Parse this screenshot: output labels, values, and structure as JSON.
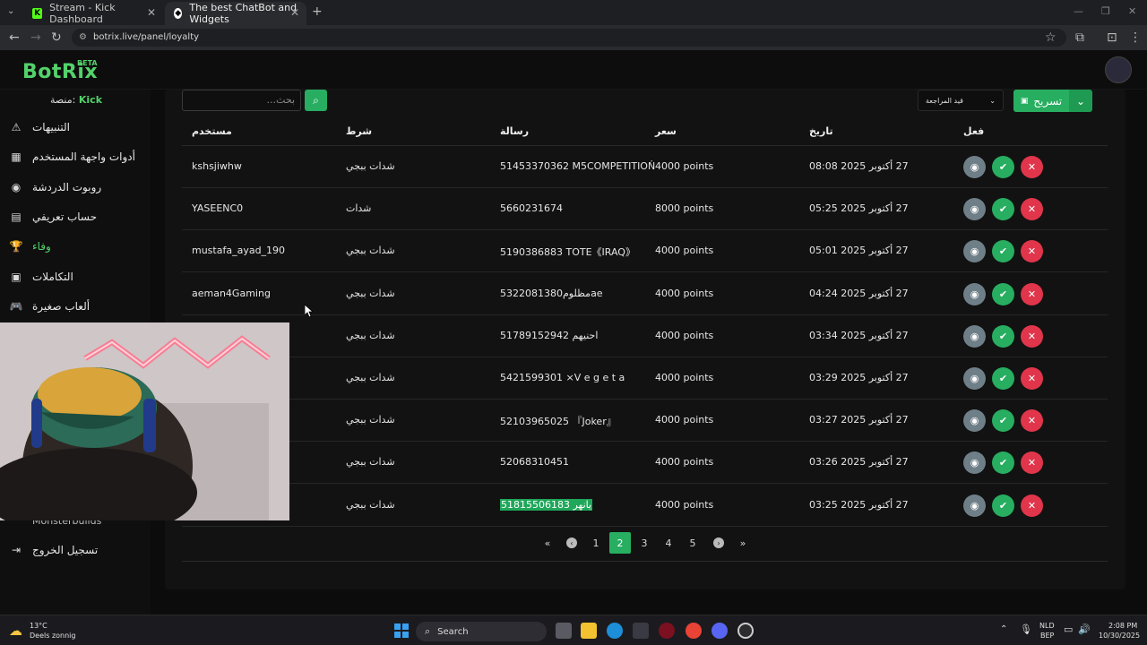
{
  "browser": {
    "tabs": [
      {
        "title": "Stream - Kick Dashboard",
        "active": false
      },
      {
        "title": "The best ChatBot and Widgets",
        "active": true
      }
    ],
    "url": "botrix.live/panel/loyalty"
  },
  "app": {
    "logo": "BotRix",
    "beta": "BETA"
  },
  "sidebar": {
    "platform_label": "منصة:",
    "platform_value": "Kick",
    "items": [
      {
        "label": "التنبيهات",
        "icon": "warning-icon"
      },
      {
        "label": "أدوات واجهة المستخدم",
        "icon": "table-icon"
      },
      {
        "label": "روبوت الدردشة",
        "icon": "robot-icon"
      },
      {
        "label": "حساب تعريفي",
        "icon": "id-card-icon"
      },
      {
        "label": "وفاء",
        "icon": "trophy-icon",
        "active": true
      },
      {
        "label": "التكاملات",
        "icon": "integration-icon"
      },
      {
        "label": "ألعاب صغيرة",
        "icon": "gamepad-icon"
      }
    ],
    "hidden_item": "Monsterbuilds",
    "logout": "تسجيل الخروج"
  },
  "toolbar": {
    "search_placeholder": "بحث...",
    "filter_value": "قيد المراجعة",
    "export_label": "تسريح"
  },
  "table": {
    "headers": {
      "user": "مستخدم",
      "condition": "شرط",
      "message": "رسالة",
      "price": "سعر",
      "date": "تاريخ",
      "action": "فعل"
    },
    "rows": [
      {
        "user": "kshsjiwhw",
        "condition": "شدات ببجي",
        "message": "51453370362 M5COMPETITIOŃ",
        "price": "4000 points",
        "date": "27 أكتوبر 2025 08:08"
      },
      {
        "user": "YASEENC0",
        "condition": "شدات",
        "message": "5660231674",
        "price": "8000 points",
        "date": "27 أكتوبر 2025 05:25"
      },
      {
        "user": "mustafa_ayad_190",
        "condition": "شدات ببجي",
        "message": "5190386883 TOTE《IRAQ》",
        "price": "4000 points",
        "date": "27 أكتوبر 2025 05:01"
      },
      {
        "user": "aeman4Gaming",
        "condition": "شدات ببجي",
        "message": "5322081380مظلومae",
        "price": "4000 points",
        "date": "27 أكتوبر 2025 04:24"
      },
      {
        "user": "",
        "condition": "شدات ببجي",
        "message": "51789152942 احنيهم",
        "price": "4000 points",
        "date": "27 أكتوبر 2025 03:34"
      },
      {
        "user": "",
        "condition": "شدات ببجي",
        "message": "5421599301 ×V e g e t a",
        "price": "4000 points",
        "date": "27 أكتوبر 2025 03:29"
      },
      {
        "user": "",
        "condition": "شدات ببجي",
        "message": "52103965025 『Joker』",
        "price": "4000 points",
        "date": "27 أكتوبر 2025 03:27"
      },
      {
        "user": "",
        "condition": "شدات ببجي",
        "message": "52068310451",
        "price": "4000 points",
        "date": "27 أكتوبر 2025 03:26"
      },
      {
        "user": "",
        "condition": "شدات ببجي",
        "message": "51815506183 يانهر",
        "price": "4000 points",
        "date": "27 أكتوبر 2025 03:25",
        "highlight": true
      }
    ]
  },
  "pagination": {
    "first": "«",
    "prev": "‹",
    "pages": [
      "1",
      "2",
      "3",
      "4",
      "5"
    ],
    "current": "2",
    "next": "›",
    "last": "»"
  },
  "taskbar": {
    "weather_temp": "13°C",
    "weather_desc": "Deels zonnig",
    "search": "Search",
    "lang_top": "NLD",
    "lang_bottom": "BEP",
    "time": "2:08 PM",
    "date": "10/30/2025"
  }
}
